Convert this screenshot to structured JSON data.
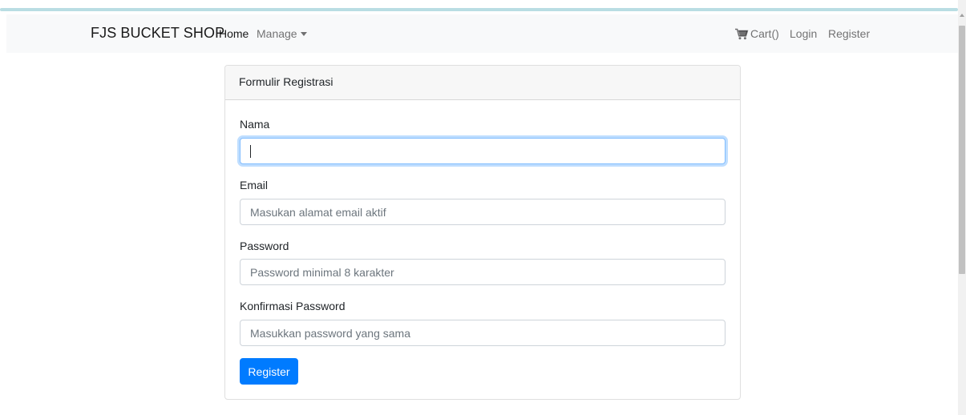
{
  "navbar": {
    "brand": "FJS BUCKET SHOP",
    "home_label": "Home",
    "manage_label": "Manage",
    "cart_label": "Cart()",
    "login_label": "Login",
    "register_label": "Register",
    "cart_icon": "shopping-cart-icon"
  },
  "form": {
    "header": "Formulir Registrasi",
    "nama": {
      "label": "Nama",
      "value": "",
      "placeholder": ""
    },
    "email": {
      "label": "Email",
      "value": "",
      "placeholder": "Masukan alamat email aktif"
    },
    "password": {
      "label": "Password",
      "value": "",
      "placeholder": "Password minimal 8 karakter"
    },
    "confirm": {
      "label": "Konfirmasi Password",
      "value": "",
      "placeholder": "Masukkan password yang sama"
    },
    "submit_label": "Register"
  },
  "colors": {
    "primary": "#007bff",
    "navbar_bg": "#f8f9fa",
    "focus_border": "#80bdff"
  }
}
